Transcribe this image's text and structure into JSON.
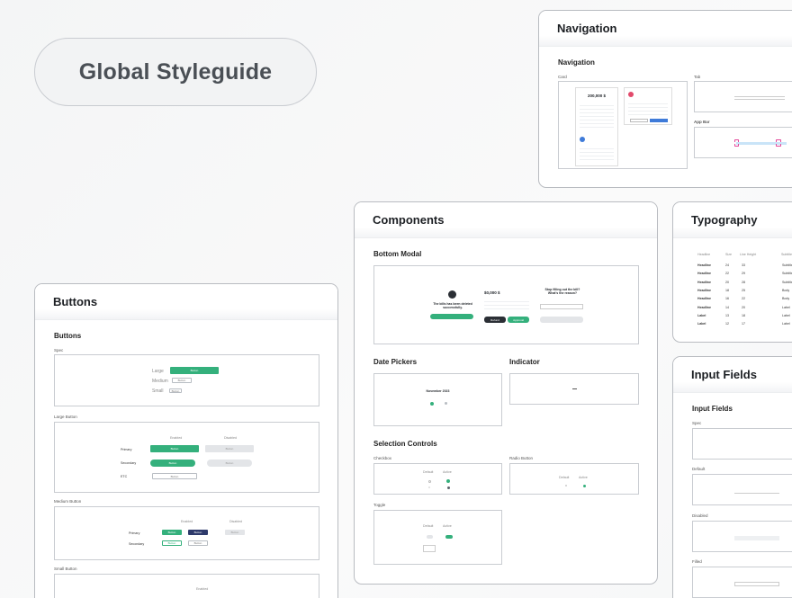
{
  "hero": {
    "title": "Global Styleguide"
  },
  "navigation": {
    "panel_title": "Navigation",
    "section_title": "Navigation",
    "labels": {
      "card": "Card",
      "tab": "Tab",
      "app_bar": "App Bar"
    },
    "card_amount": "200,000 $"
  },
  "components": {
    "panel_title": "Components",
    "bottom_modal": {
      "title": "Bottom Modal",
      "deleted_msg_line1": "The bills has been deleted",
      "deleted_msg_line2": "successfully.",
      "amount": "$0,000 $",
      "question_line1": "Stop filling out the bill?",
      "question_line2": "What's the reason?",
      "refund_label": "Refund",
      "approval_label": "Approval"
    },
    "date_pickers": {
      "title": "Date Pickers",
      "month": "November 2023"
    },
    "indicator": {
      "title": "Indicator"
    },
    "selection_controls": {
      "title": "Selection Controls",
      "checkbox": "Checkbox",
      "radio": "Radio Button",
      "toggle": "Toggle",
      "default": "Default",
      "active": "Active"
    }
  },
  "buttons": {
    "panel_title": "Buttons",
    "section_title": "Buttons",
    "spec_label": "Spec",
    "sizes": {
      "large": "Large",
      "medium": "Medium",
      "small": "Small"
    },
    "button_text": "Button",
    "large_button": "Large Button",
    "medium_button": "Medium Button",
    "small_button": "Small Button",
    "columns": {
      "enabled": "Enabled",
      "disabled": "Disabled"
    },
    "rows": {
      "primary": "Primary",
      "secondary": "Secondary",
      "etc": "ETC"
    }
  },
  "typography": {
    "panel_title": "Typography",
    "headers": [
      "Headline",
      "Size",
      "Line Height",
      "Subtitle"
    ],
    "rows": [
      {
        "name": "Headline",
        "size": "24",
        "lh": "33",
        "sub": "Subtitle"
      },
      {
        "name": "Headline",
        "size": "22",
        "lh": "29",
        "sub": "Subtitle"
      },
      {
        "name": "Headline",
        "size": "20",
        "lh": "28",
        "sub": "Subtitle"
      },
      {
        "name": "Headline",
        "size": "18",
        "lh": "25",
        "sub": "Body"
      },
      {
        "name": "Headline",
        "size": "16",
        "lh": "22",
        "sub": "Body"
      },
      {
        "name": "Headline",
        "size": "14",
        "lh": "20",
        "sub": "Label"
      },
      {
        "name": "Label",
        "size": "13",
        "lh": "18",
        "sub": "Label"
      },
      {
        "name": "Label",
        "size": "12",
        "lh": "17",
        "sub": "Label"
      }
    ]
  },
  "input_fields": {
    "panel_title": "Input Fields",
    "section_title": "Input Fields",
    "labels": {
      "spec": "Spec",
      "default": "Default",
      "disabled": "Disabled",
      "filled": "Filled"
    }
  },
  "colors": {
    "green": "#34b07c",
    "navy": "#2e3a6b",
    "blue": "#3f7bd9",
    "border": "#b9bcc1"
  }
}
